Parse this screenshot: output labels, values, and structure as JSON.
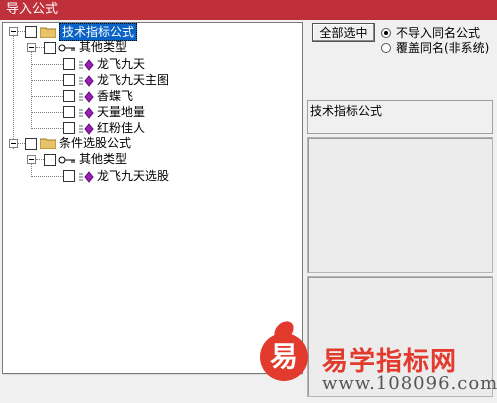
{
  "window": {
    "title": "导入公式"
  },
  "tree": {
    "group_technical": {
      "label": "技术指标公式"
    },
    "sub_other_1": {
      "label": "其他类型"
    },
    "items_technical": [
      {
        "label": "龙飞九天"
      },
      {
        "label": "龙飞九天主图"
      },
      {
        "label": "香蝶飞"
      },
      {
        "label": "天量地量"
      },
      {
        "label": "红粉佳人"
      }
    ],
    "group_stock": {
      "label": "条件选股公式"
    },
    "sub_other_2": {
      "label": "其他类型"
    },
    "items_stock": [
      {
        "label": "龙飞九天选股"
      }
    ]
  },
  "buttons": {
    "select_all": "全部选中"
  },
  "options": {
    "no_import_same": "不导入同名公式",
    "overwrite_same": "覆盖同名(非系统)",
    "selected": "no_import_same"
  },
  "info": {
    "formula_type": "技术指标公式"
  },
  "watermark": {
    "title": "易学指标网",
    "url": "www.108096.com",
    "logo_char": "易"
  },
  "colors": {
    "titlebar": "#c0303a",
    "selection": "#0a64c8",
    "watermark": "#e23a2c",
    "formula_icon": "#9b1fb8"
  }
}
